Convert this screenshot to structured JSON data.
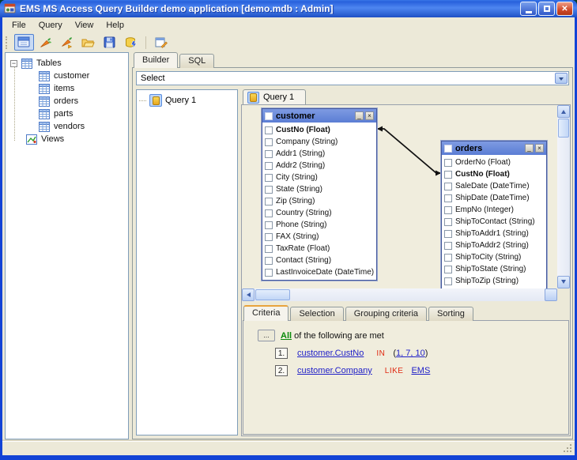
{
  "colors": {
    "titlebar_blue": "#2E63D4",
    "window_border": "#1243D6",
    "client_bg": "#ECE9D8",
    "canvas_bg": "#F0EDDD",
    "table_titlebar_blue": "#5B7DD4",
    "link_blue": "#2020C8",
    "operator_red": "#E02810",
    "all_green": "#0A8A0A",
    "active_tab_accent": "#E8A33D"
  },
  "window": {
    "title": "EMS MS Access Query Builder demo application [demo.mdb : Admin]"
  },
  "menu": {
    "items": [
      "File",
      "Query",
      "View",
      "Help"
    ]
  },
  "toolbar": {
    "buttons": [
      "new-query",
      "connect-database",
      "disconnect-database",
      "open-query",
      "save-query",
      "execute-query",
      "edit-query"
    ]
  },
  "sidebar": {
    "root_label": "Tables",
    "tables": [
      "customer",
      "items",
      "orders",
      "parts",
      "vendors"
    ],
    "views_label": "Views"
  },
  "builder": {
    "tabs": [
      "Builder",
      "SQL"
    ],
    "active_tab": "Builder",
    "combo_value": "Select",
    "query_node_label": "Query 1",
    "query_tab_label": "Query 1"
  },
  "diagram": {
    "join": {
      "from": "customer.CustNo",
      "to": "orders.CustNo"
    },
    "windows": [
      {
        "title": "customer",
        "fields": [
          {
            "label": "CustNo (Float)",
            "key": true
          },
          {
            "label": "Company (String)",
            "key": false
          },
          {
            "label": "Addr1 (String)",
            "key": false
          },
          {
            "label": "Addr2 (String)",
            "key": false
          },
          {
            "label": "City (String)",
            "key": false
          },
          {
            "label": "State (String)",
            "key": false
          },
          {
            "label": "Zip (String)",
            "key": false
          },
          {
            "label": "Country (String)",
            "key": false
          },
          {
            "label": "Phone (String)",
            "key": false
          },
          {
            "label": "FAX (String)",
            "key": false
          },
          {
            "label": "TaxRate (Float)",
            "key": false
          },
          {
            "label": "Contact (String)",
            "key": false
          },
          {
            "label": "LastInvoiceDate (DateTime)",
            "key": false
          }
        ]
      },
      {
        "title": "orders",
        "fields": [
          {
            "label": "OrderNo (Float)",
            "key": false
          },
          {
            "label": "CustNo (Float)",
            "key": true
          },
          {
            "label": "SaleDate (DateTime)",
            "key": false
          },
          {
            "label": "ShipDate (DateTime)",
            "key": false
          },
          {
            "label": "EmpNo (Integer)",
            "key": false
          },
          {
            "label": "ShipToContact (String)",
            "key": false
          },
          {
            "label": "ShipToAddr1 (String)",
            "key": false
          },
          {
            "label": "ShipToAddr2 (String)",
            "key": false
          },
          {
            "label": "ShipToCity (String)",
            "key": false
          },
          {
            "label": "ShipToState (String)",
            "key": false
          },
          {
            "label": "ShipToZip (String)",
            "key": false
          },
          {
            "label": "",
            "key": false
          }
        ]
      }
    ]
  },
  "bottom": {
    "tabs": [
      "Criteria",
      "Selection",
      "Grouping criteria",
      "Sorting"
    ],
    "active_tab": "Criteria"
  },
  "criteria": {
    "options_button": "...",
    "all_label": "All",
    "suffix_label": "of the following are met",
    "conditions": [
      {
        "num": "1.",
        "field": "customer.CustNo",
        "op": "IN",
        "value_open": "(",
        "value": "1, 7, 10",
        "value_close": ")"
      },
      {
        "num": "2.",
        "field": "customer.Company",
        "op": "LIKE",
        "value_open": "",
        "value": "EMS",
        "value_close": ""
      }
    ]
  }
}
